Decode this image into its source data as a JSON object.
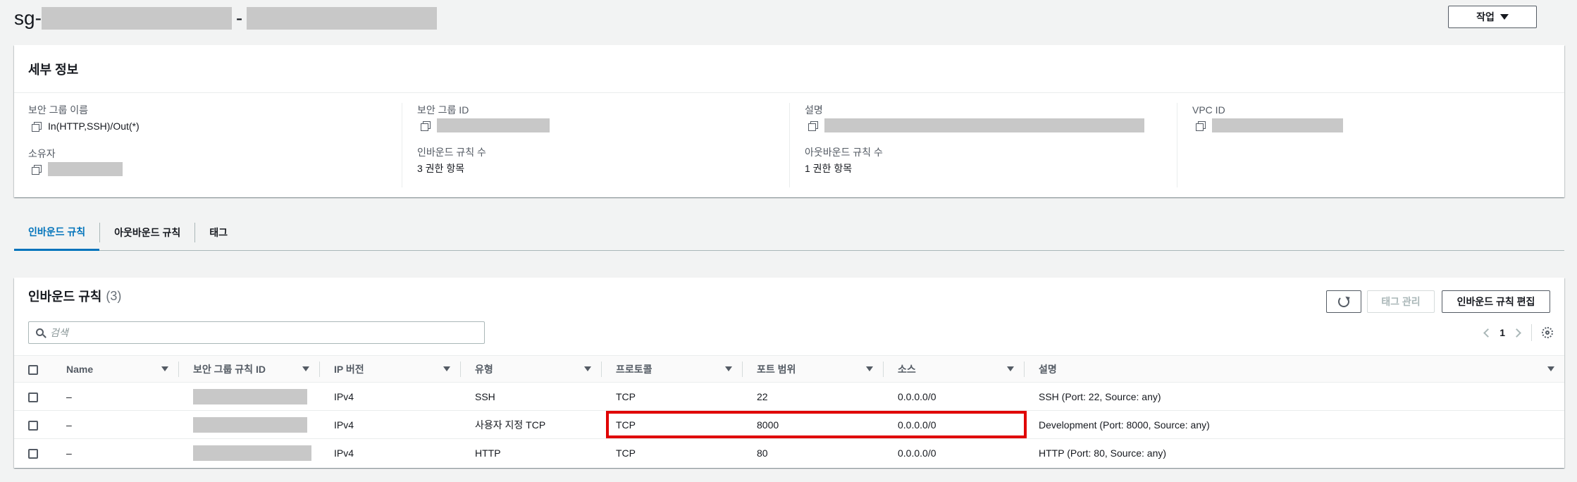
{
  "header": {
    "title_prefix": "sg-",
    "title_dash": "-",
    "actions_label": "작업"
  },
  "details": {
    "heading": "세부 정보",
    "fields": {
      "sg_name_label": "보안 그룹 이름",
      "sg_name_value": "In(HTTP,SSH)/Out(*)",
      "sg_id_label": "보안 그룹 ID",
      "description_label": "설명",
      "vpc_id_label": "VPC ID",
      "owner_label": "소유자",
      "inbound_count_label": "인바운드 규칙 수",
      "inbound_count_value": "3 권한 항목",
      "outbound_count_label": "아웃바운드 규칙 수",
      "outbound_count_value": "1 권한 항목"
    }
  },
  "tabs": [
    {
      "label": "인바운드 규칙",
      "active": true
    },
    {
      "label": "아웃바운드 규칙",
      "active": false
    },
    {
      "label": "태그",
      "active": false
    }
  ],
  "rules": {
    "title": "인바운드 규칙",
    "count": "(3)",
    "manage_tags_label": "태그 관리",
    "edit_rules_label": "인바운드 규칙 편집",
    "search_placeholder": "검색",
    "page": "1",
    "columns": [
      "Name",
      "보안 그룹 규칙 ID",
      "IP 버전",
      "유형",
      "프로토콜",
      "포트 범위",
      "소스",
      "설명"
    ],
    "rows": [
      {
        "name": "–",
        "ip_version": "IPv4",
        "type": "SSH",
        "protocol": "TCP",
        "port": "22",
        "source": "0.0.0.0/0",
        "description": "SSH (Port: 22, Source: any)"
      },
      {
        "name": "–",
        "ip_version": "IPv4",
        "type": "사용자 지정 TCP",
        "protocol": "TCP",
        "port": "8000",
        "source": "0.0.0.0/0",
        "description": "Development (Port: 8000, Source: any)"
      },
      {
        "name": "–",
        "ip_version": "IPv4",
        "type": "HTTP",
        "protocol": "TCP",
        "port": "80",
        "source": "0.0.0.0/0",
        "description": "HTTP (Port: 80, Source: any)"
      }
    ]
  },
  "colors": {
    "accent": "#0073bb",
    "highlight": "#e00000",
    "redaction": "#c8c8c8"
  }
}
